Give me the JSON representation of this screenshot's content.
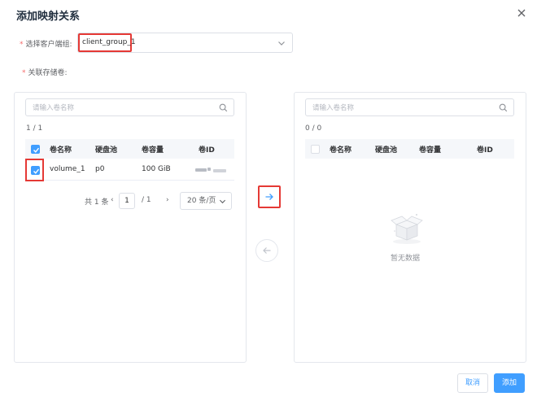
{
  "dialog": {
    "title": "添加映射关系"
  },
  "form": {
    "client_group_label": "选择客户端组:",
    "client_group_value": "client_group_1",
    "volumes_label": "关联存储卷:"
  },
  "left_panel": {
    "search_placeholder": "请输入卷名称",
    "count": "1 / 1",
    "columns": [
      "卷名称",
      "硬盘池",
      "卷容量",
      "卷ID"
    ],
    "rows": [
      {
        "name": "volume_1",
        "pool": "p0",
        "capacity": "100 GiB",
        "checked": true
      }
    ],
    "header_checked": true,
    "pagination": {
      "total": "共 1 条",
      "prev": "‹",
      "page": "1",
      "of": "/ 1",
      "next": "›",
      "page_size": "20 条/页"
    }
  },
  "right_panel": {
    "search_placeholder": "请输入卷名称",
    "count": "0 / 0",
    "columns": [
      "卷名称",
      "硬盘池",
      "卷容量",
      "卷ID"
    ],
    "empty_text": "暂无数据"
  },
  "footer": {
    "cancel": "取消",
    "add": "添加"
  },
  "colors": {
    "primary": "#409eff",
    "highlight": "#e53935",
    "required": "#f56c6c"
  }
}
